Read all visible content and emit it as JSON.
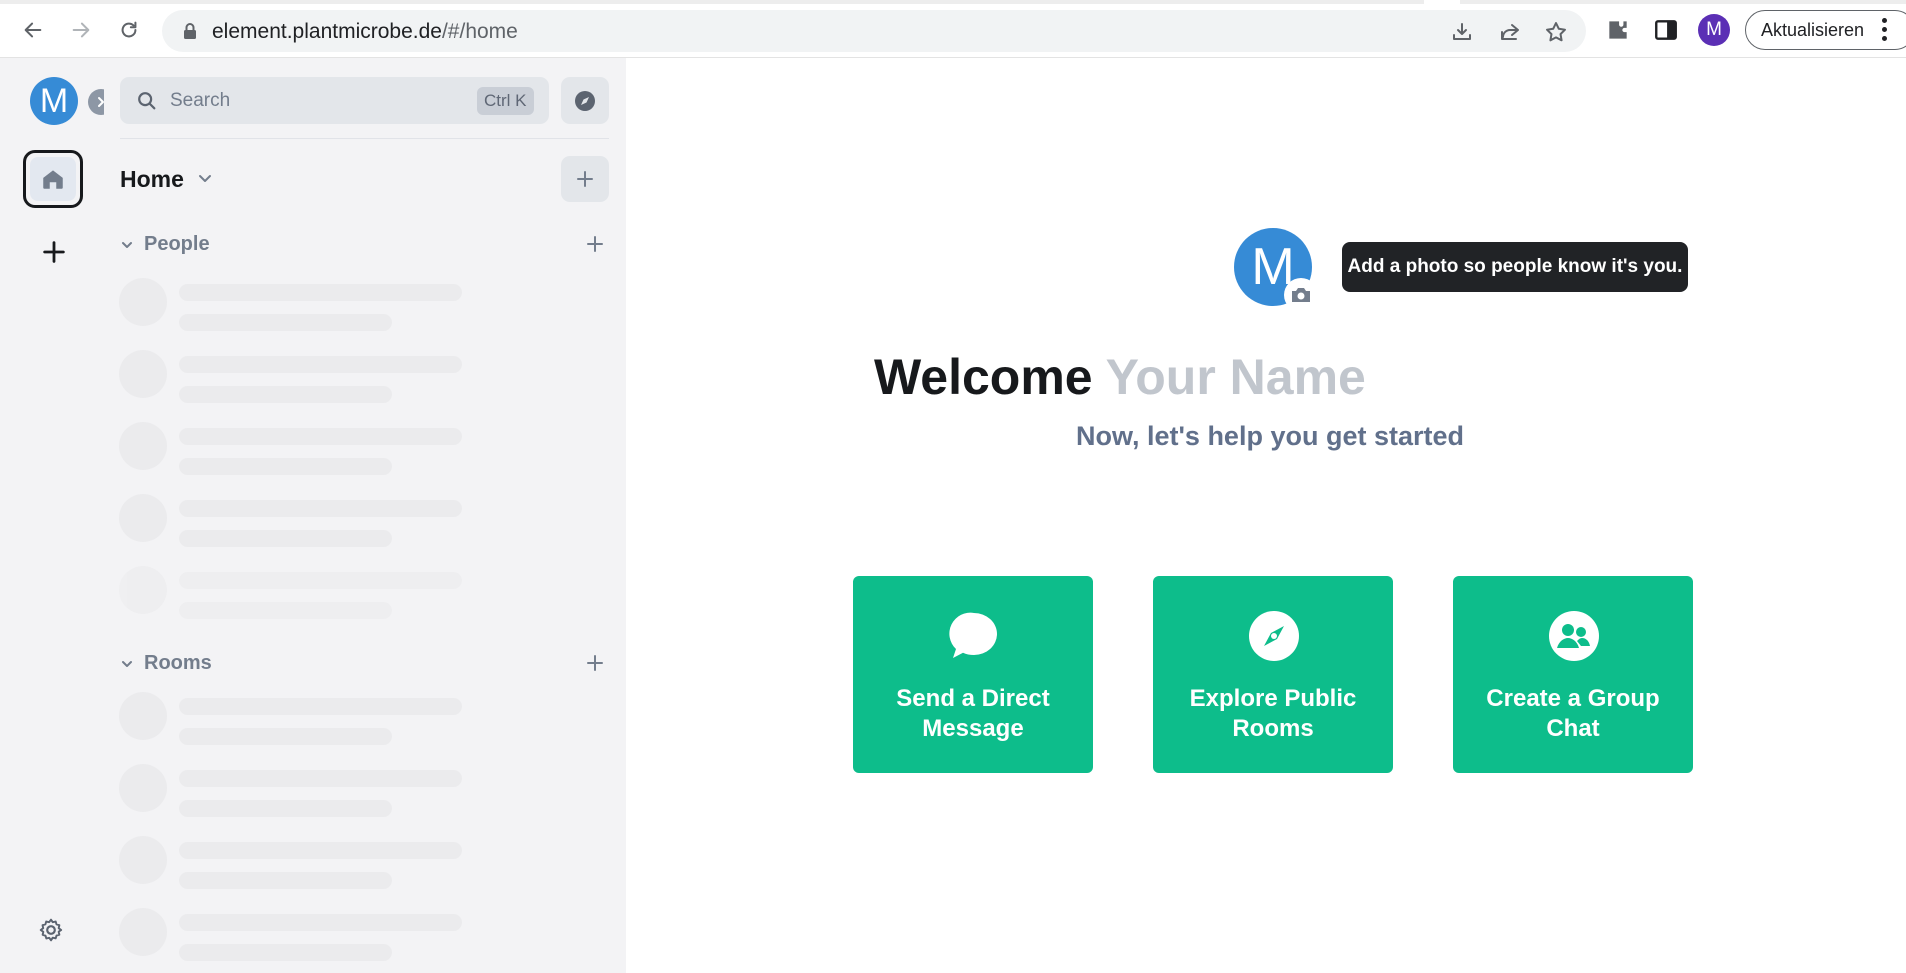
{
  "browser": {
    "url_host": "element.plantmicrobe.de",
    "url_path": "/#/home",
    "profile_initial": "M",
    "update_label": "Aktualisieren"
  },
  "sidebar": {
    "user_initial": "M",
    "search_placeholder": "Search",
    "search_shortcut": "Ctrl K",
    "home_title": "Home",
    "sections": [
      {
        "label": "People",
        "skeleton_rows": 5
      },
      {
        "label": "Rooms",
        "skeleton_rows": 4
      }
    ]
  },
  "main": {
    "avatar_initial": "M",
    "tooltip": "Add a photo so people know it's you.",
    "welcome_prefix": "Welcome",
    "welcome_name": "Your Name",
    "subtitle": "Now, let's help you get started",
    "actions": [
      {
        "label": "Send a Direct Message",
        "icon": "chat-bubble-icon"
      },
      {
        "label": "Explore Public Rooms",
        "icon": "compass-icon"
      },
      {
        "label": "Create a Group Chat",
        "icon": "group-icon"
      }
    ]
  },
  "colors": {
    "accent": "#0dbd8b",
    "avatar": "#368bd6",
    "sidebar_bg": "#f3f3f5"
  }
}
